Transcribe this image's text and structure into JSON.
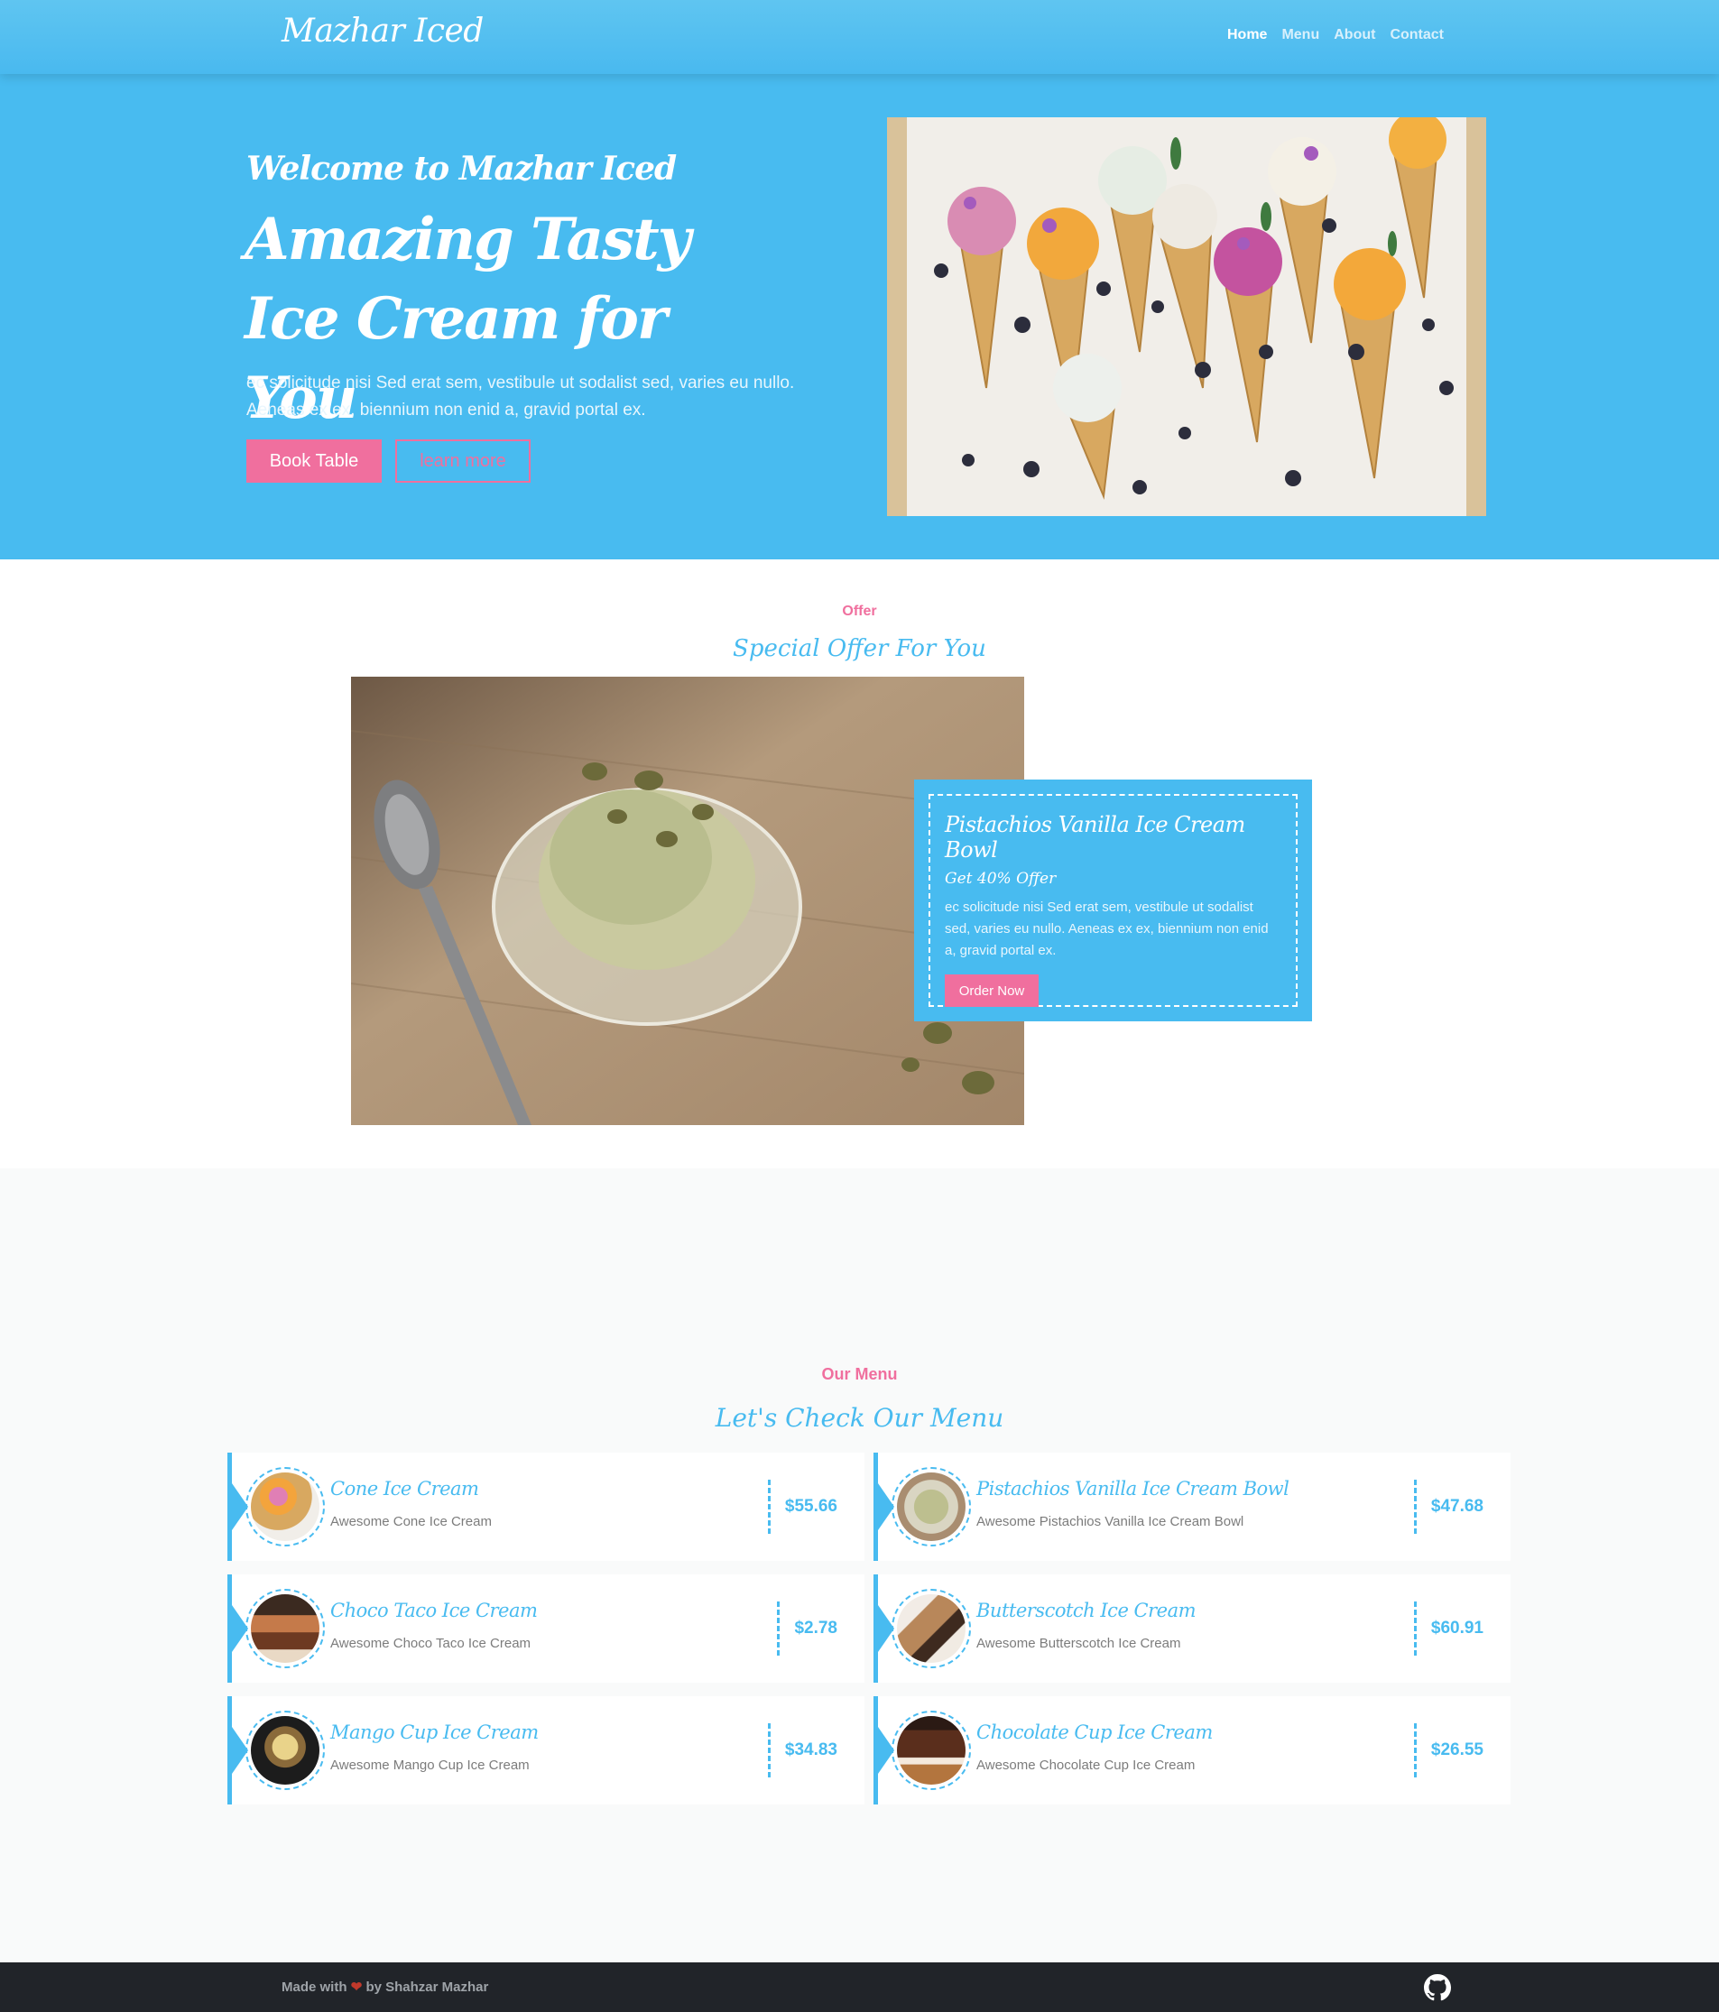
{
  "brand": "Mazhar Iced",
  "nav": {
    "home": "Home",
    "menu": "Menu",
    "about": "About",
    "contact": "Contact"
  },
  "hero": {
    "subtitle": "Welcome to Mazhar Iced",
    "title": "Amazing Tasty Ice Cream for You",
    "text": "ec solicitude nisi Sed erat sem, vestibule ut sodalist sed, varies eu nullo. Aeneas ex ex, biennium non enid a, gravid portal ex.",
    "book_label": "Book Table",
    "learn_label": "learn more"
  },
  "offer": {
    "tag": "Offer",
    "title": "Special Offer For You",
    "card_title": "Pistachios Vanilla Ice Cream Bowl",
    "card_sub": "Get 40% Offer",
    "card_text": "ec solicitude nisi Sed erat sem, vestibule ut sodalist sed, varies eu nullo. Aeneas ex ex, biennium non enid a, gravid portal ex.",
    "order_label": "Order Now"
  },
  "menu": {
    "tag": "Our Menu",
    "title": "Let's Check Our Menu",
    "items": [
      {
        "name": "Cone Ice Cream",
        "desc": "Awesome Cone Ice Cream",
        "price": "$55.66"
      },
      {
        "name": "Pistachios Vanilla Ice Cream Bowl",
        "desc": "Awesome Pistachios Vanilla Ice Cream Bowl",
        "price": "$47.68"
      },
      {
        "name": "Choco Taco Ice Cream",
        "desc": "Awesome Choco Taco Ice Cream",
        "price": "$2.78"
      },
      {
        "name": "Butterscotch Ice Cream",
        "desc": "Awesome Butterscotch Ice Cream",
        "price": "$60.91"
      },
      {
        "name": "Mango Cup Ice Cream",
        "desc": "Awesome Mango Cup Ice Cream",
        "price": "$34.83"
      },
      {
        "name": "Chocolate Cup Ice Cream",
        "desc": "Awesome Chocolate Cup Ice Cream",
        "price": "$26.55"
      }
    ]
  },
  "footer": {
    "made_with": "Made with",
    "by": "by Shahzar Mazhar",
    "heart_icon": "heart-icon",
    "github_icon": "github-icon"
  },
  "colors": {
    "primary": "#48bbf0",
    "accent": "#f06f9e",
    "footer": "#212429",
    "section_bg": "#f9fafa"
  }
}
